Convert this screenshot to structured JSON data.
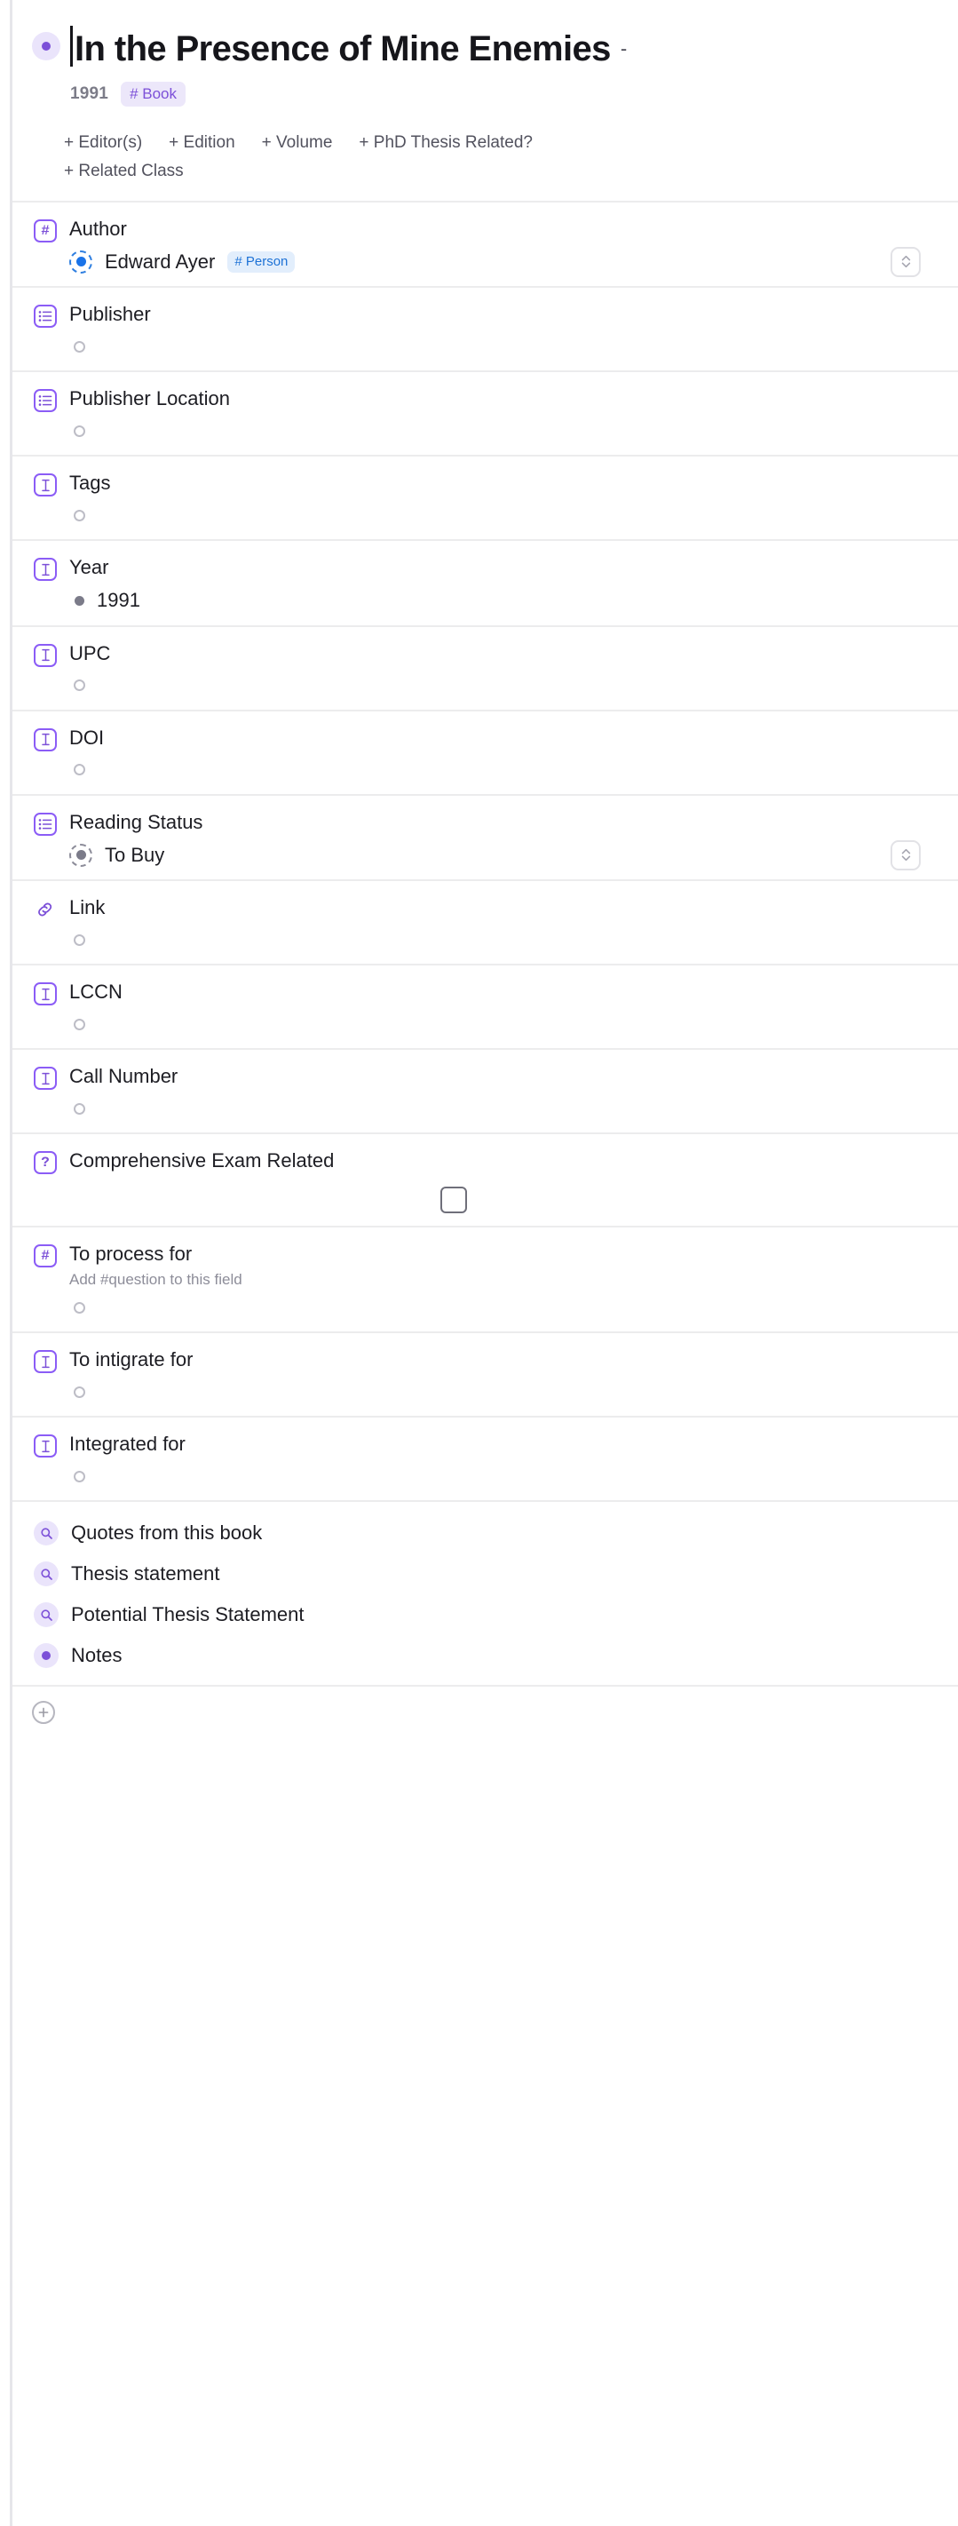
{
  "document": {
    "bullet_icon": "purple-dot-bullet",
    "title": "In the Presence of Mine Enemies",
    "title_suffix": "-",
    "year": "1991",
    "type_tag": "# Book"
  },
  "add_fields": [
    {
      "label": "+ Editor(s)",
      "name": "editors"
    },
    {
      "label": "+ Edition",
      "name": "edition"
    },
    {
      "label": "+ Volume",
      "name": "volume"
    },
    {
      "label": "+ PhD Thesis Related?",
      "name": "phd-thesis-related"
    },
    {
      "label": "+ Related Class",
      "name": "related-class"
    }
  ],
  "fields": [
    {
      "name": "author",
      "label": "Author",
      "icon": "hash-icon",
      "value_kind": "entity",
      "value": "Edward Ayer",
      "value_tag": "# Person",
      "bullet": "blue-dashed-ring",
      "stepper": true
    },
    {
      "name": "publisher",
      "label": "Publisher",
      "icon": "list-icon",
      "value_kind": "empty",
      "value": "",
      "bullet": "empty-circle"
    },
    {
      "name": "publisher-location",
      "label": "Publisher Location",
      "icon": "list-icon",
      "value_kind": "empty",
      "value": "",
      "bullet": "empty-circle"
    },
    {
      "name": "tags",
      "label": "Tags",
      "icon": "text-cursor-icon",
      "value_kind": "empty",
      "value": "",
      "bullet": "empty-circle"
    },
    {
      "name": "year",
      "label": "Year",
      "icon": "text-cursor-icon",
      "value_kind": "text",
      "value": "1991",
      "bullet": "solid-dot"
    },
    {
      "name": "upc",
      "label": "UPC",
      "icon": "text-cursor-icon",
      "value_kind": "empty",
      "value": "",
      "bullet": "empty-circle"
    },
    {
      "name": "doi",
      "label": "DOI",
      "icon": "text-cursor-icon",
      "value_kind": "empty",
      "value": "",
      "bullet": "empty-circle"
    },
    {
      "name": "reading-status",
      "label": "Reading Status",
      "icon": "list-icon",
      "value_kind": "option",
      "value": "To Buy",
      "bullet": "gray-dashed-ring",
      "stepper": true
    },
    {
      "name": "link",
      "label": "Link",
      "icon": "link-icon",
      "value_kind": "empty",
      "value": "",
      "bullet": "empty-circle"
    },
    {
      "name": "lccn",
      "label": "LCCN",
      "icon": "text-cursor-icon",
      "value_kind": "empty",
      "value": "",
      "bullet": "empty-circle"
    },
    {
      "name": "call-number",
      "label": "Call Number",
      "icon": "text-cursor-icon",
      "value_kind": "empty",
      "value": "",
      "bullet": "empty-circle"
    },
    {
      "name": "comprehensive-exam-related",
      "label": "Comprehensive Exam Related",
      "icon": "question-icon",
      "value_kind": "checkbox",
      "checked": false
    },
    {
      "name": "to-process-for",
      "label": "To process for",
      "hint": "Add #question to this field",
      "icon": "hash-icon",
      "value_kind": "empty",
      "value": "",
      "bullet": "empty-circle"
    },
    {
      "name": "to-intigrate-for",
      "label": "To intigrate for",
      "icon": "text-cursor-icon",
      "value_kind": "empty",
      "value": "",
      "bullet": "empty-circle"
    },
    {
      "name": "integrated-for",
      "label": "Integrated for",
      "icon": "text-cursor-icon",
      "value_kind": "empty",
      "value": "",
      "bullet": "empty-circle"
    }
  ],
  "links": [
    {
      "name": "quotes-from-this-book",
      "label": "Quotes from this book",
      "icon": "search-icon"
    },
    {
      "name": "thesis-statement",
      "label": "Thesis statement",
      "icon": "search-icon"
    },
    {
      "name": "potential-thesis-statement",
      "label": "Potential Thesis Statement",
      "icon": "search-icon"
    },
    {
      "name": "notes",
      "label": "Notes",
      "icon": "bullet-dot-icon"
    }
  ],
  "footer": {
    "add_block_icon": "plus-circle-icon"
  },
  "colors": {
    "accent_purple": "#7c50d8",
    "tag_purple_bg": "#ece7fa",
    "tag_blue_bg": "#e2eefc",
    "tag_blue_text": "#1d72d6",
    "divider": "#ececed",
    "muted_text": "#8d8d99"
  }
}
